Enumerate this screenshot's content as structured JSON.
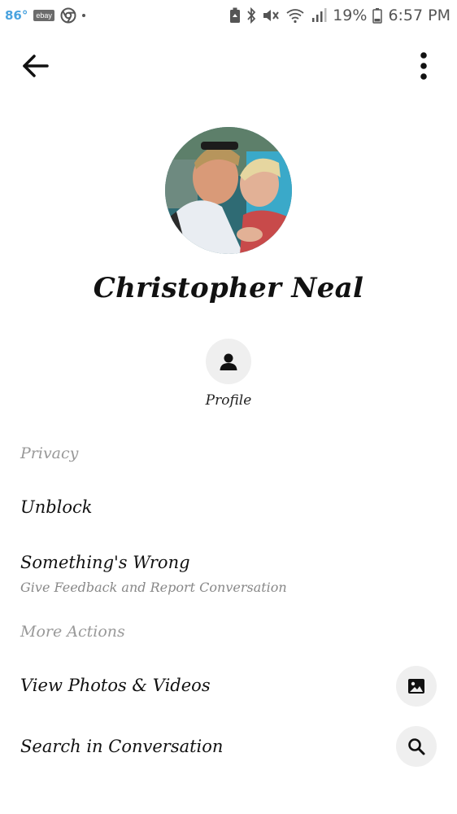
{
  "status_bar": {
    "temperature": "86°",
    "ebay": "ebay",
    "battery": "19%",
    "time": "6:57 PM"
  },
  "contact": {
    "name": "Christopher Neal"
  },
  "actions": {
    "profile_label": "Profile"
  },
  "privacy": {
    "header": "Privacy",
    "unblock": "Unblock",
    "something_wrong": "Something's Wrong",
    "something_wrong_sub": "Give Feedback and Report Conversation"
  },
  "more_actions": {
    "header": "More Actions",
    "view_media": "View Photos & Videos",
    "search": "Search in Conversation"
  },
  "icons": {
    "back": "arrow-left-icon",
    "more": "more-vertical-icon",
    "profile": "person-icon",
    "photos": "image-icon",
    "search": "search-icon"
  }
}
